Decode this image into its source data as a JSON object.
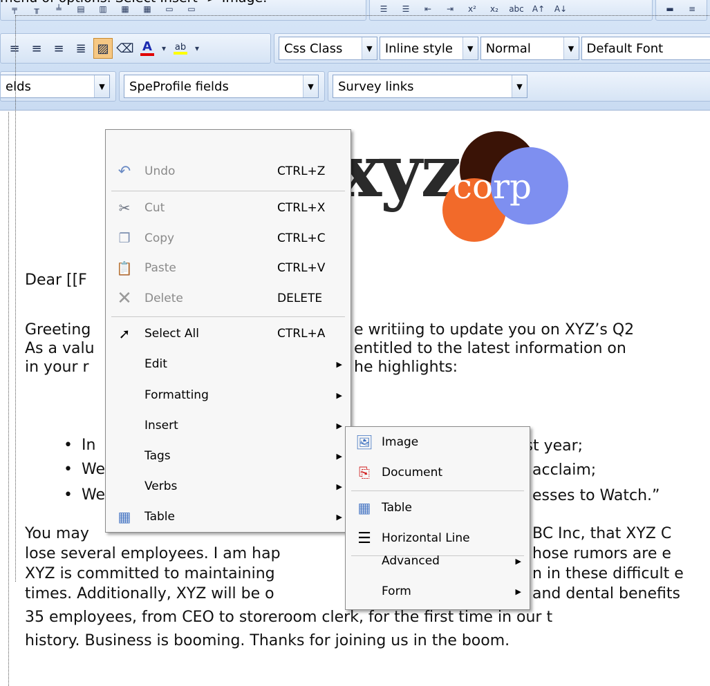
{
  "caption": "menu of options. Select Insert -> Image.",
  "toolbar": {
    "row1_icons": [
      "table-insert-row-icon",
      "table-insert-col-icon",
      "table-delete-icon",
      "merge-cells-icon",
      "split-cells-icon",
      "list-bulleted-icon",
      "list-numbered-icon",
      "outdent-icon",
      "indent-icon",
      "superscript-icon",
      "subscript-icon",
      "strikethrough-icon",
      "grow-font-icon",
      "shrink-font-icon",
      "horizontal-rule-icon"
    ],
    "css_class_label": "Css Class",
    "inline_style_label": "Inline style",
    "paragraph_label": "Normal",
    "font_label": "Default Font",
    "fields_label": "elds",
    "speprofile_label": "SpeProfile fields",
    "survey_label": "Survey links",
    "font_color_glyph": "A",
    "highlight_glyph": "ab"
  },
  "document": {
    "logo_text": "xyz",
    "logo_sub": "corp",
    "greeting": "Dear [[F",
    "line1_left": "Greeting",
    "line1_right": "e writiing to update you on XYZ’s Q2",
    "line2_left": "As a valu",
    "line2_right": "entitled to the latest information on",
    "line3_left": "in your r",
    "line3_right": "he highlights:",
    "bullets": [
      {
        "left": "In",
        "right": "ast year;"
      },
      {
        "left": "We",
        "right": "acclaim;"
      },
      {
        "left": "We",
        "right": "esses to Watch.”"
      }
    ],
    "para_line1_left": "You may",
    "para_line1_right": "BC Inc, that XYZ C",
    "para_line2_left": "lose several employees. I am hap",
    "para_line2_right": "hose rumors are e",
    "para_line3_left": "XYZ is committed to maintaining",
    "para_line3_right": "n in these difficult e",
    "para_line4_left": "times. Additionally, XYZ will be o",
    "para_line4_right": "and dental benefits",
    "para_line5": "35 employees, from CEO to storeroom clerk, for the first time in our t",
    "para_line6": "history. Business is booming. Thanks for joining us in the boom."
  },
  "context_menu": {
    "items": [
      {
        "label": "Undo",
        "shortcut": "CTRL+Z",
        "icon": "undo-icon",
        "disabled": true
      },
      {
        "label": "Cut",
        "shortcut": "CTRL+X",
        "icon": "scissors-icon",
        "disabled": true
      },
      {
        "label": "Copy",
        "shortcut": "CTRL+C",
        "icon": "copy-icon",
        "disabled": true
      },
      {
        "label": "Paste",
        "shortcut": "CTRL+V",
        "icon": "paste-icon",
        "disabled": true
      },
      {
        "label": "Delete",
        "shortcut": "DELETE",
        "icon": "delete-icon",
        "disabled": true
      },
      {
        "label": "Select All",
        "shortcut": "CTRL+A",
        "icon": "select-all-icon",
        "disabled": false
      },
      {
        "label": "Edit",
        "shortcut": "",
        "icon": "",
        "disabled": false,
        "submenu": true
      },
      {
        "label": "Formatting",
        "shortcut": "",
        "icon": "",
        "disabled": false,
        "submenu": true
      },
      {
        "label": "Insert",
        "shortcut": "",
        "icon": "",
        "disabled": false,
        "submenu": true
      },
      {
        "label": "Tags",
        "shortcut": "",
        "icon": "",
        "disabled": false,
        "submenu": true
      },
      {
        "label": "Verbs",
        "shortcut": "",
        "icon": "",
        "disabled": false,
        "submenu": true
      },
      {
        "label": "Table",
        "shortcut": "",
        "icon": "table-icon",
        "disabled": false,
        "submenu": true
      }
    ]
  },
  "insert_submenu": {
    "items": [
      {
        "label": "Image",
        "icon": "image-icon",
        "submenu": false
      },
      {
        "label": "Document",
        "icon": "pdf-document-icon",
        "submenu": false
      },
      {
        "label": "Table",
        "icon": "table-icon",
        "submenu": false
      },
      {
        "label": "Horizontal Line",
        "icon": "horizontal-line-icon",
        "submenu": false
      },
      {
        "label": "Advanced",
        "icon": "",
        "submenu": true
      },
      {
        "label": "Form",
        "icon": "",
        "submenu": true
      }
    ]
  },
  "colors": {
    "toolbar_bg": "#d0e0f5",
    "active_button": "#f6c884",
    "logo_dark": "#3a1306",
    "logo_orange": "#f26a2a",
    "logo_blue": "#7e8ff0",
    "font_color_red": "#e00000",
    "highlight_yellow": "#ffff00"
  }
}
